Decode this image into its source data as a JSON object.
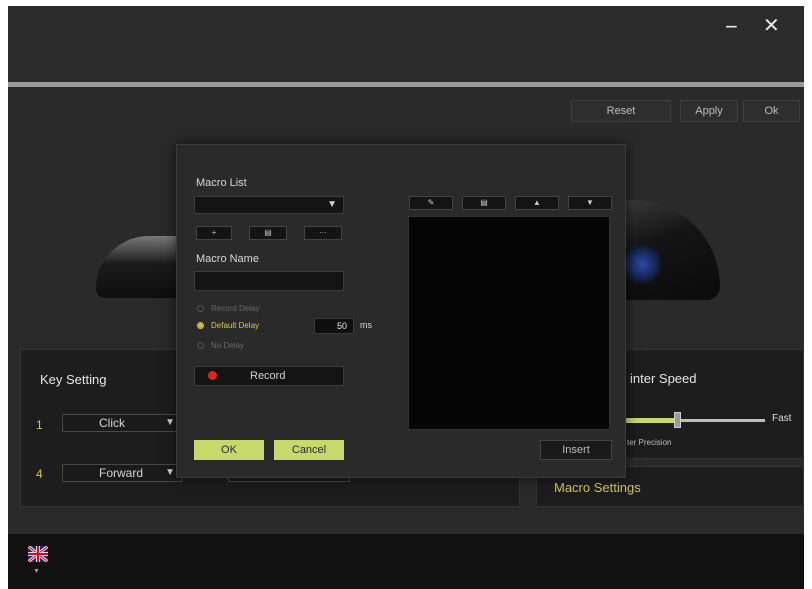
{
  "window": {
    "minimize": "−",
    "close": "✕"
  },
  "toolbar": {
    "reset": "Reset",
    "apply": "Apply",
    "ok": "Ok"
  },
  "key_setting": {
    "title": "Key Setting",
    "rows": [
      {
        "num": "1",
        "value": "Click"
      },
      {
        "num": "4",
        "value": "Forward"
      }
    ]
  },
  "pointer_speed": {
    "title": "inter Speed",
    "fast_label": "Fast",
    "precision_label": "ter Precision",
    "level": 0.37
  },
  "macro_settings_link": "Macro Settings",
  "macro_dialog": {
    "macro_list_label": "Macro List",
    "macro_list_value": "",
    "list_buttons": [
      "+",
      "▤",
      "···"
    ],
    "macro_name_label": "Macro Name",
    "macro_name_value": "",
    "delay_options": [
      {
        "label": "Record Delay",
        "selected": false
      },
      {
        "label": "Default Delay",
        "selected": true
      },
      {
        "label": "No Delay",
        "selected": false
      }
    ],
    "default_delay_value": "50",
    "delay_unit": "ms",
    "record_label": "Record",
    "ok_label": "OK",
    "cancel_label": "Cancel",
    "toolbar_icons": [
      "pencil-icon",
      "delete-icon",
      "move-up-icon",
      "move-down-icon"
    ],
    "toolbar_glyphs": [
      "✎",
      "▤",
      "▲",
      "▼"
    ],
    "insert_label": "Insert"
  },
  "colors": {
    "accent": "#c7d96b",
    "highlight_text": "#d8c64a",
    "record": "#e0241e"
  }
}
